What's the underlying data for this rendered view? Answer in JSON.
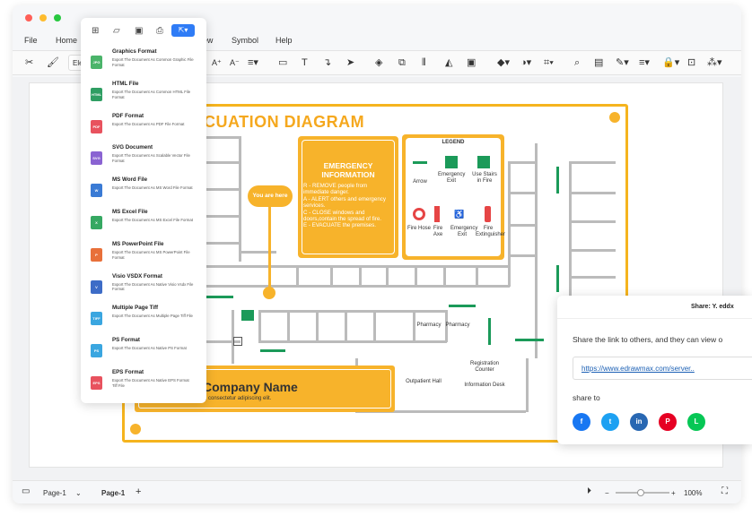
{
  "menu": [
    "File",
    "Home",
    "View",
    "Symbol",
    "Help"
  ],
  "toolbar": {
    "font_name": "Ele"
  },
  "file_menu": {
    "items": [
      {
        "title": "Graphics Format",
        "desc": "Export The Document As Common Graphic File Format",
        "icon": "JPG",
        "color": "#4bb46a"
      },
      {
        "title": "HTML File",
        "desc": "Export The Document As Common HTML File Format",
        "icon": "HTML",
        "color": "#2f9e63"
      },
      {
        "title": "PDF Format",
        "desc": "Export The Document As PDF File Format",
        "icon": "PDF",
        "color": "#e8525e"
      },
      {
        "title": "SVG Document",
        "desc": "Export The Document As Scalable Vector File Format",
        "icon": "SVG",
        "color": "#8a63d2"
      },
      {
        "title": "MS Word File",
        "desc": "Export The Document As MS Word File Format",
        "icon": "W",
        "color": "#3a7bd5"
      },
      {
        "title": "MS Excel File",
        "desc": "Export The Document As MS Excel File Format",
        "icon": "X",
        "color": "#36a862"
      },
      {
        "title": "MS PowerPoint File",
        "desc": "Export The Document As MS PowerPoint File Format",
        "icon": "P",
        "color": "#e8703a"
      },
      {
        "title": "Visio VSDX Format",
        "desc": "Export The Document As Native Visio Vsdx File Format",
        "icon": "V",
        "color": "#3d6cc7"
      },
      {
        "title": "Multiple Page Tiff",
        "desc": "Export The Document As Multiple Page Tiff File",
        "icon": "TIFF",
        "color": "#3aa6e0"
      },
      {
        "title": "PS Format",
        "desc": "Export The Document As Native PS Format",
        "icon": "PS",
        "color": "#3aa6e0"
      },
      {
        "title": "EPS Format",
        "desc": "Export The Document As Native EPS Format Tiff File",
        "icon": "EPS",
        "color": "#e8525e"
      }
    ]
  },
  "diagram": {
    "title": "CUATION DIAGRAM",
    "emergency_title": "EMERGENCY INFORMATION",
    "emergency_lines": [
      "R - REMOVE people from immediate danger.",
      "A - ALERT others and emergency services.",
      "C - CLOSE windows and doors,contain the spread of fire.",
      "E - EVACUATE the premises."
    ],
    "legend_title": "LEGEND",
    "legend_items": [
      "Arrow",
      "Emergency Exit",
      "Use Stairs in Fire",
      "Fire Hose",
      "Fire Axe",
      "Emergency Exit",
      "Fire Extinguisher"
    ],
    "you_are_here": "You are here",
    "company_name": "Company Name",
    "company_text": "olor sit amet, consectetur adipiscing elit.",
    "rooms": [
      "Pharmacy",
      "Pharmacy",
      "Outpatient Hall",
      "Registration Counter",
      "Information Desk"
    ]
  },
  "share": {
    "header": "Share: Y. eddx",
    "message": "Share the link to others, and they can view o",
    "link": "https://www.edrawmax.com/server..",
    "share_to": "share to",
    "networks": [
      {
        "name": "facebook",
        "glyph": "f",
        "color": "#1877f2"
      },
      {
        "name": "twitter",
        "glyph": "t",
        "color": "#1da1f2"
      },
      {
        "name": "linkedin",
        "glyph": "in",
        "color": "#2867b2"
      },
      {
        "name": "pinterest",
        "glyph": "P",
        "color": "#e60023"
      },
      {
        "name": "line",
        "glyph": "L",
        "color": "#06c755"
      }
    ]
  },
  "status": {
    "page_select": "Page-1",
    "page_tab": "Page-1",
    "add": "+",
    "zoom": "100%"
  }
}
